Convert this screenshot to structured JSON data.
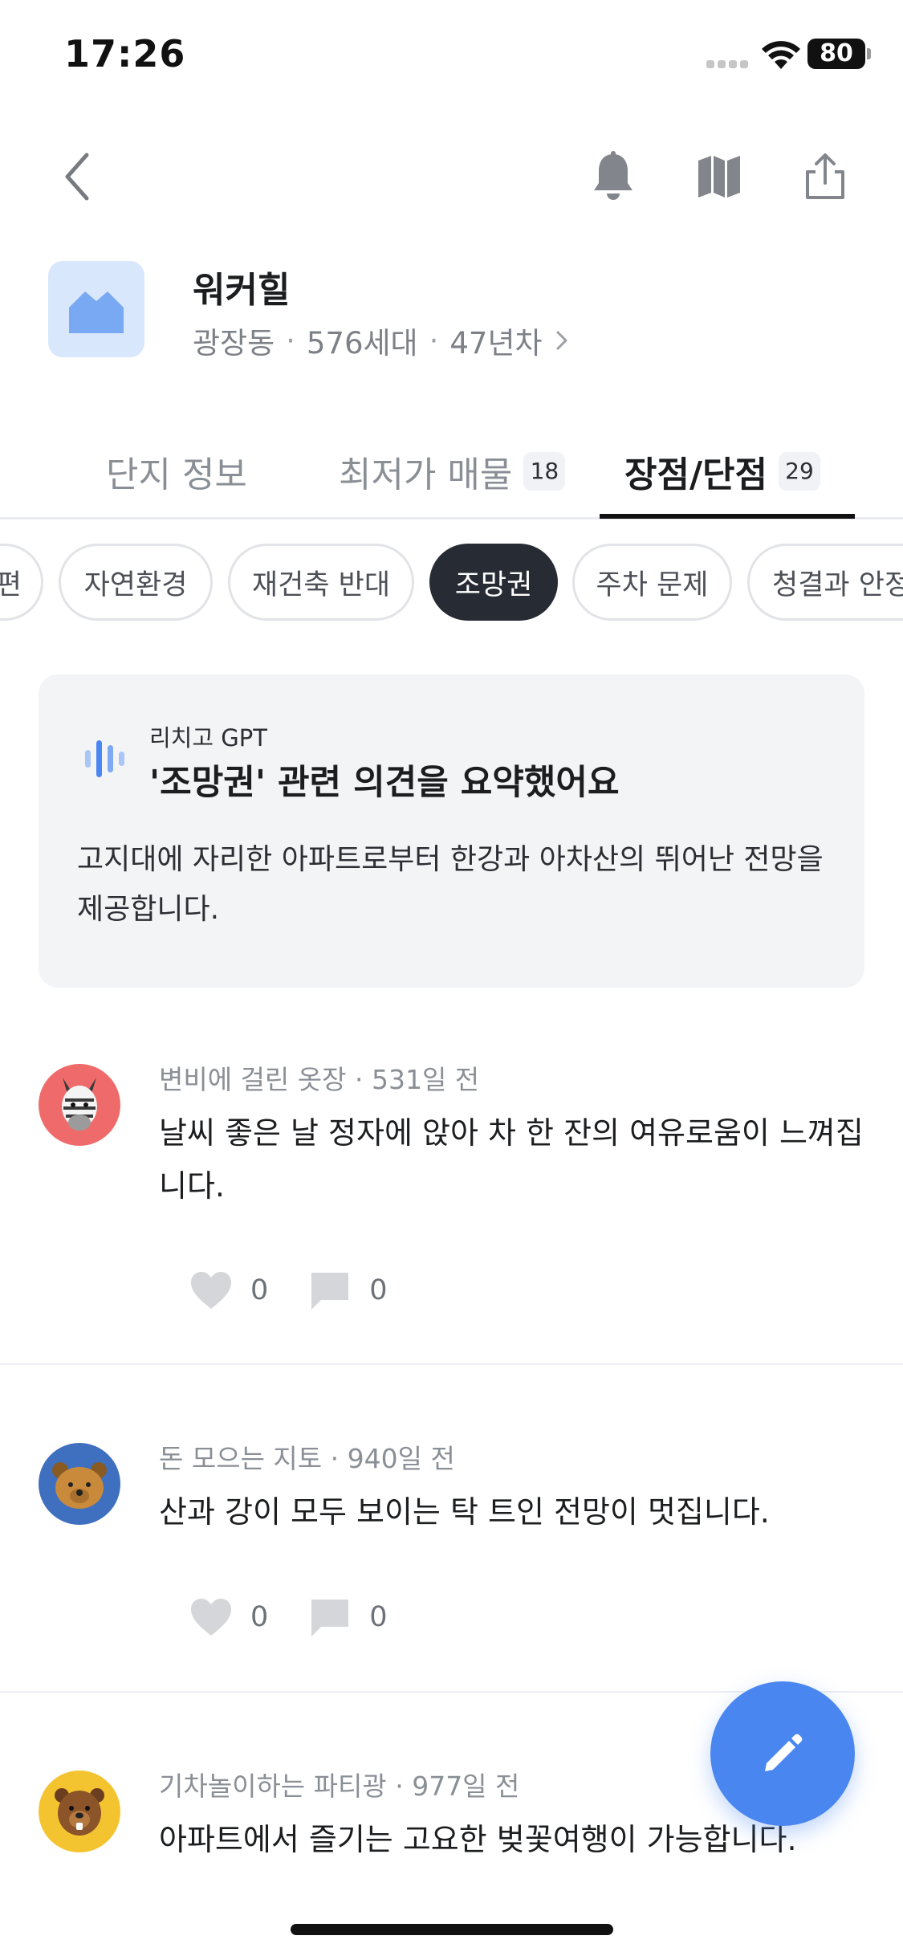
{
  "status_bar": {
    "time": "17:26",
    "battery": "80"
  },
  "header": {
    "complex_name": "워커힐",
    "district": "광장동",
    "households": "576세대",
    "age": "47년차",
    "separator": "·"
  },
  "tabs": [
    {
      "label": "단지 정보",
      "count": null
    },
    {
      "label": "최저가 매물",
      "count": "18"
    },
    {
      "label": "장점/단점",
      "count": "29"
    }
  ],
  "filter_chips": [
    "편",
    "자연환경",
    "재건축 반대",
    "조망권",
    "주차 문제",
    "청결과 안정"
  ],
  "active_chip": "조망권",
  "summary": {
    "source_label": "리치고 GPT",
    "title": "'조망권' 관련 의견을 요약했어요",
    "body": "고지대에 자리한 아파트로부터 한강과 아차산의 뛰어난 전망을 제공합니다."
  },
  "posts": [
    {
      "author": "변비에 걸린 옷장",
      "time": "531일 전",
      "meta": "변비에 걸린 옷장 · 531일 전",
      "text": "날씨 좋은 날 정자에 앉아 차 한 잔의 여유로움이 느껴집니다.",
      "likes": "0",
      "comments": "0",
      "avatar_icon": "zebra-icon",
      "avatar_color": "#ef6b6b"
    },
    {
      "author": "돈 모으는 지토",
      "time": "940일 전",
      "meta": "돈 모으는 지토 · 940일 전",
      "text": "산과 강이 모두 보이는 탁 트인 전망이 멋집니다.",
      "likes": "0",
      "comments": "0",
      "avatar_icon": "bear-icon",
      "avatar_color": "#3f6fbf"
    },
    {
      "author": "기차놀이하는 파티광",
      "time": "977일 전",
      "meta": "기차놀이하는 파티광 · 977일 전",
      "text": "아파트에서 즐기는 고요한 벚꽃여행이 가능합니다.",
      "likes": "",
      "comments": "",
      "avatar_icon": "beaver-icon",
      "avatar_color": "#f4c430"
    }
  ],
  "colors": {
    "accent": "#4a86f0",
    "active_chip_bg": "#272b33",
    "card_bg": "#f3f4f6"
  },
  "icons": {
    "back": "chevron-left-icon",
    "notify": "bell-icon",
    "map": "map-icon",
    "share": "share-icon",
    "write": "pencil-icon"
  }
}
